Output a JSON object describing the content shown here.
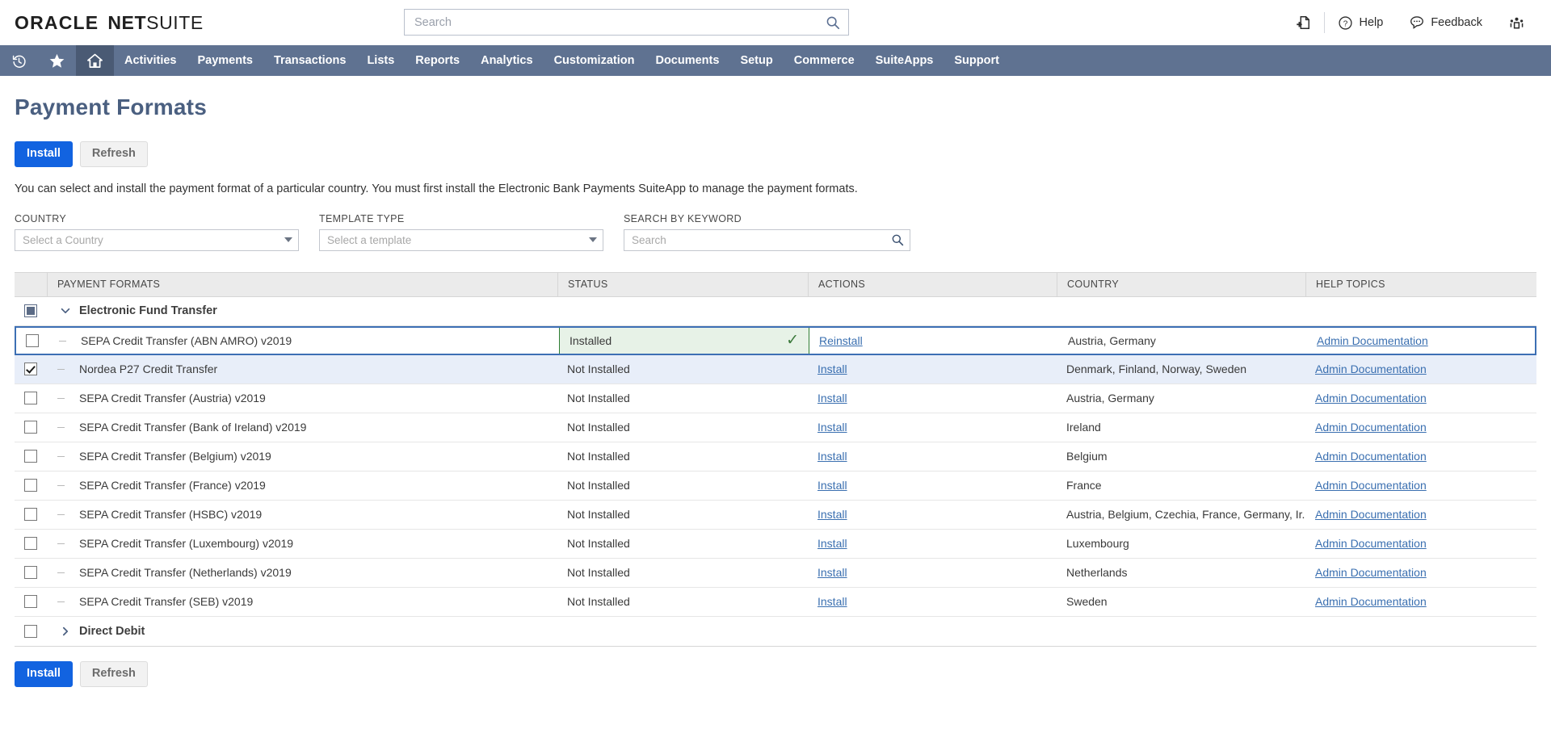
{
  "brand": {
    "oracle": "ORACLE",
    "net": "NET",
    "suite": "SUITE"
  },
  "global_search": {
    "placeholder": "Search",
    "value": "",
    "icon": "search-icon"
  },
  "header_actions": [
    {
      "name": "new-document-icon",
      "label": "",
      "icon": "add-document-icon"
    },
    {
      "name": "help",
      "label": "Help",
      "icon": "question-circle-icon"
    },
    {
      "name": "feedback",
      "label": "Feedback",
      "icon": "speech-bubble-icon"
    },
    {
      "name": "people",
      "label": "",
      "icon": "people-group-icon"
    }
  ],
  "nav": {
    "icons": [
      {
        "name": "recent-history-icon",
        "icon": "clock-rewind-icon",
        "active": false
      },
      {
        "name": "favorites-icon",
        "icon": "star-icon",
        "active": false
      },
      {
        "name": "home-icon",
        "icon": "home-icon",
        "active": true
      }
    ],
    "items": [
      "Activities",
      "Payments",
      "Transactions",
      "Lists",
      "Reports",
      "Analytics",
      "Customization",
      "Documents",
      "Setup",
      "Commerce",
      "SuiteApps",
      "Support"
    ]
  },
  "page": {
    "title": "Payment Formats",
    "description": "You can select and install the payment format of a particular country. You must first install the Electronic Bank Payments SuiteApp to manage the payment formats.",
    "install_label": "Install",
    "refresh_label": "Refresh"
  },
  "filters": {
    "country": {
      "label": "COUNTRY",
      "placeholder": "Select a Country",
      "value": ""
    },
    "template": {
      "label": "TEMPLATE TYPE",
      "placeholder": "Select a template",
      "value": ""
    },
    "keyword": {
      "label": "SEARCH BY KEYWORD",
      "placeholder": "Search",
      "value": ""
    }
  },
  "table": {
    "headers": [
      "PAYMENT FORMATS",
      "STATUS",
      "ACTIONS",
      "COUNTRY",
      "HELP TOPICS"
    ],
    "groups": [
      {
        "name": "Electronic Fund Transfer",
        "expanded": true,
        "checkbox": "indeterminate",
        "chevron": "chevron-down-icon",
        "rows": [
          {
            "checked": false,
            "focused": true,
            "name": "SEPA Credit Transfer (ABN AMRO) v2019",
            "status": "Installed",
            "installed": true,
            "action": "Reinstall",
            "country": "Austria, Germany",
            "help": "Admin Documentation"
          },
          {
            "checked": true,
            "focused": false,
            "name": "Nordea P27 Credit Transfer",
            "status": "Not Installed",
            "installed": false,
            "action": "Install",
            "country": "Denmark, Finland, Norway, Sweden",
            "help": "Admin Documentation"
          },
          {
            "checked": false,
            "focused": false,
            "name": "SEPA Credit Transfer (Austria) v2019",
            "status": "Not Installed",
            "installed": false,
            "action": "Install",
            "country": "Austria, Germany",
            "help": "Admin Documentation"
          },
          {
            "checked": false,
            "focused": false,
            "name": "SEPA Credit Transfer (Bank of Ireland) v2019",
            "status": "Not Installed",
            "installed": false,
            "action": "Install",
            "country": "Ireland",
            "help": "Admin Documentation"
          },
          {
            "checked": false,
            "focused": false,
            "name": "SEPA Credit Transfer (Belgium) v2019",
            "status": "Not Installed",
            "installed": false,
            "action": "Install",
            "country": "Belgium",
            "help": "Admin Documentation"
          },
          {
            "checked": false,
            "focused": false,
            "name": "SEPA Credit Transfer (France) v2019",
            "status": "Not Installed",
            "installed": false,
            "action": "Install",
            "country": "France",
            "help": "Admin Documentation"
          },
          {
            "checked": false,
            "focused": false,
            "name": "SEPA Credit Transfer (HSBC) v2019",
            "status": "Not Installed",
            "installed": false,
            "action": "Install",
            "country": "Austria, Belgium, Czechia, France, Germany, Ir...",
            "help": "Admin Documentation"
          },
          {
            "checked": false,
            "focused": false,
            "name": "SEPA Credit Transfer (Luxembourg) v2019",
            "status": "Not Installed",
            "installed": false,
            "action": "Install",
            "country": "Luxembourg",
            "help": "Admin Documentation"
          },
          {
            "checked": false,
            "focused": false,
            "name": "SEPA Credit Transfer (Netherlands) v2019",
            "status": "Not Installed",
            "installed": false,
            "action": "Install",
            "country": "Netherlands",
            "help": "Admin Documentation"
          },
          {
            "checked": false,
            "focused": false,
            "name": "SEPA Credit Transfer (SEB) v2019",
            "status": "Not Installed",
            "installed": false,
            "action": "Install",
            "country": "Sweden",
            "help": "Admin Documentation"
          }
        ]
      },
      {
        "name": "Direct Debit",
        "expanded": false,
        "checkbox": "unchecked",
        "chevron": "chevron-right-icon",
        "rows": []
      }
    ]
  },
  "colors": {
    "nav_background": "#5f7291",
    "primary_button": "#1263e0",
    "title": "#4a5f80",
    "installed_background": "#e7f2e7",
    "installed_border": "#2e7d32",
    "selected_row": "#e8eef9",
    "focus_border": "#3d6fb4",
    "link": "#3a6fb0"
  }
}
